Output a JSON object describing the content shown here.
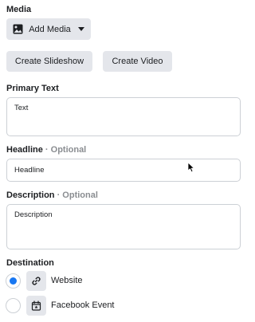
{
  "media": {
    "label": "Media",
    "add_media_label": "Add Media",
    "create_slideshow_label": "Create Slideshow",
    "create_video_label": "Create Video"
  },
  "primary_text": {
    "label": "Primary Text",
    "placeholder": "Text"
  },
  "headline": {
    "label": "Headline",
    "optional": " · Optional",
    "placeholder": "Headline"
  },
  "description": {
    "label": "Description",
    "optional": " · Optional",
    "placeholder": "Description"
  },
  "destination": {
    "label": "Destination",
    "options": [
      {
        "label": "Website",
        "icon": "link-icon",
        "selected": true
      },
      {
        "label": "Facebook Event",
        "icon": "calendar-icon",
        "selected": false
      }
    ]
  },
  "colors": {
    "accent": "#1877f2",
    "button_bg": "#e4e6eb",
    "border": "#ccd0d5",
    "optional_text": "#8a8d91"
  }
}
